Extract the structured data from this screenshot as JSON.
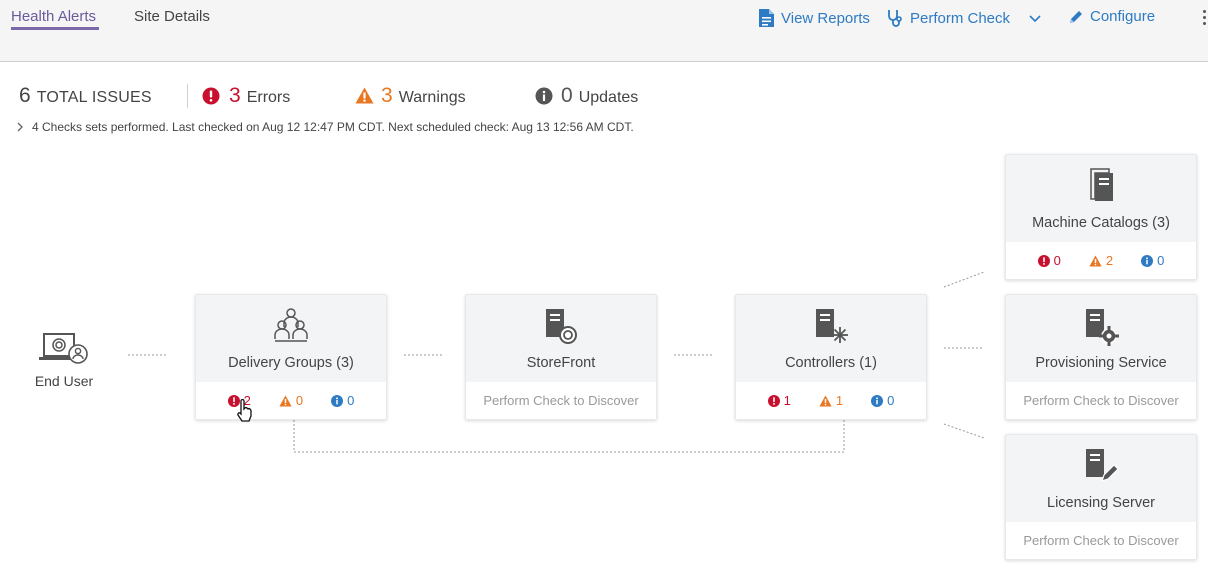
{
  "tabs": [
    {
      "label": "Health Alerts",
      "active": true
    },
    {
      "label": "Site Details",
      "active": false
    }
  ],
  "actions": {
    "view_reports": "View Reports",
    "perform_check": "Perform Check",
    "configure": "Configure"
  },
  "summary": {
    "total": {
      "count": "6",
      "label": "TOTAL ISSUES"
    },
    "errors": {
      "count": "3",
      "label": "Errors"
    },
    "warnings": {
      "count": "3",
      "label": "Warnings"
    },
    "updates": {
      "count": "0",
      "label": "Updates"
    }
  },
  "checks_line": "4 Checks sets performed. Last checked on Aug 12 12:47 PM CDT. Next scheduled check: Aug 13 12:56 AM CDT.",
  "end_user": {
    "label": "End User"
  },
  "cards": {
    "delivery_groups": {
      "title": "Delivery Groups (3)",
      "errors": "2",
      "warnings": "0",
      "info": "0"
    },
    "storefront": {
      "title": "StoreFront",
      "hint": "Perform Check to Discover"
    },
    "controllers": {
      "title": "Controllers (1)",
      "errors": "1",
      "warnings": "1",
      "info": "0"
    },
    "machine_catalogs": {
      "title": "Machine Catalogs (3)",
      "errors": "0",
      "warnings": "2",
      "info": "0"
    },
    "provisioning_service": {
      "title": "Provisioning Service",
      "hint": "Perform Check to Discover"
    },
    "licensing_server": {
      "title": "Licensing Server",
      "hint": "Perform Check to Discover"
    }
  },
  "colors": {
    "accent": "#7a68a8",
    "link": "#2e7bc4",
    "error": "#c8102e",
    "warning": "#e87722",
    "info": "#2e7bc4"
  }
}
